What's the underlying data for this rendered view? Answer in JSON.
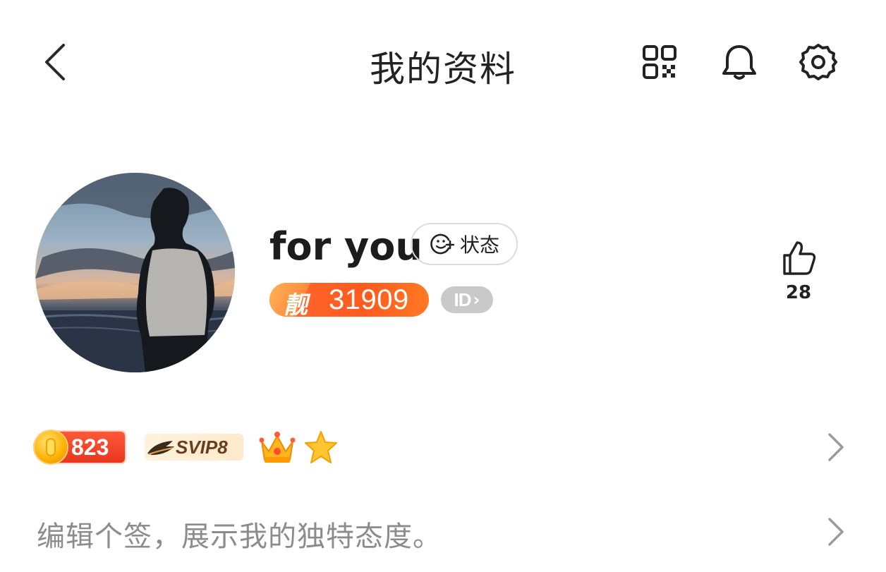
{
  "header": {
    "title": "我的资料",
    "icons": [
      "back-arrow-icon",
      "qr-code-icon",
      "bell-icon",
      "gear-icon"
    ]
  },
  "profile": {
    "username": "for you",
    "status_label": "状态",
    "pretty_number_char": "靓",
    "pretty_number": "31909",
    "id_label": "ID",
    "likes": "28"
  },
  "badges": {
    "coin_value": "823",
    "svip_label": "SVIP8"
  },
  "signature": {
    "placeholder": "编辑个签，展示我的独特态度。"
  },
  "colors": {
    "accent_orange": "#ff5a1e",
    "coin_red": "#e8341c",
    "id_gray": "#c9c9c9",
    "placeholder_gray": "#8c8c8c"
  }
}
